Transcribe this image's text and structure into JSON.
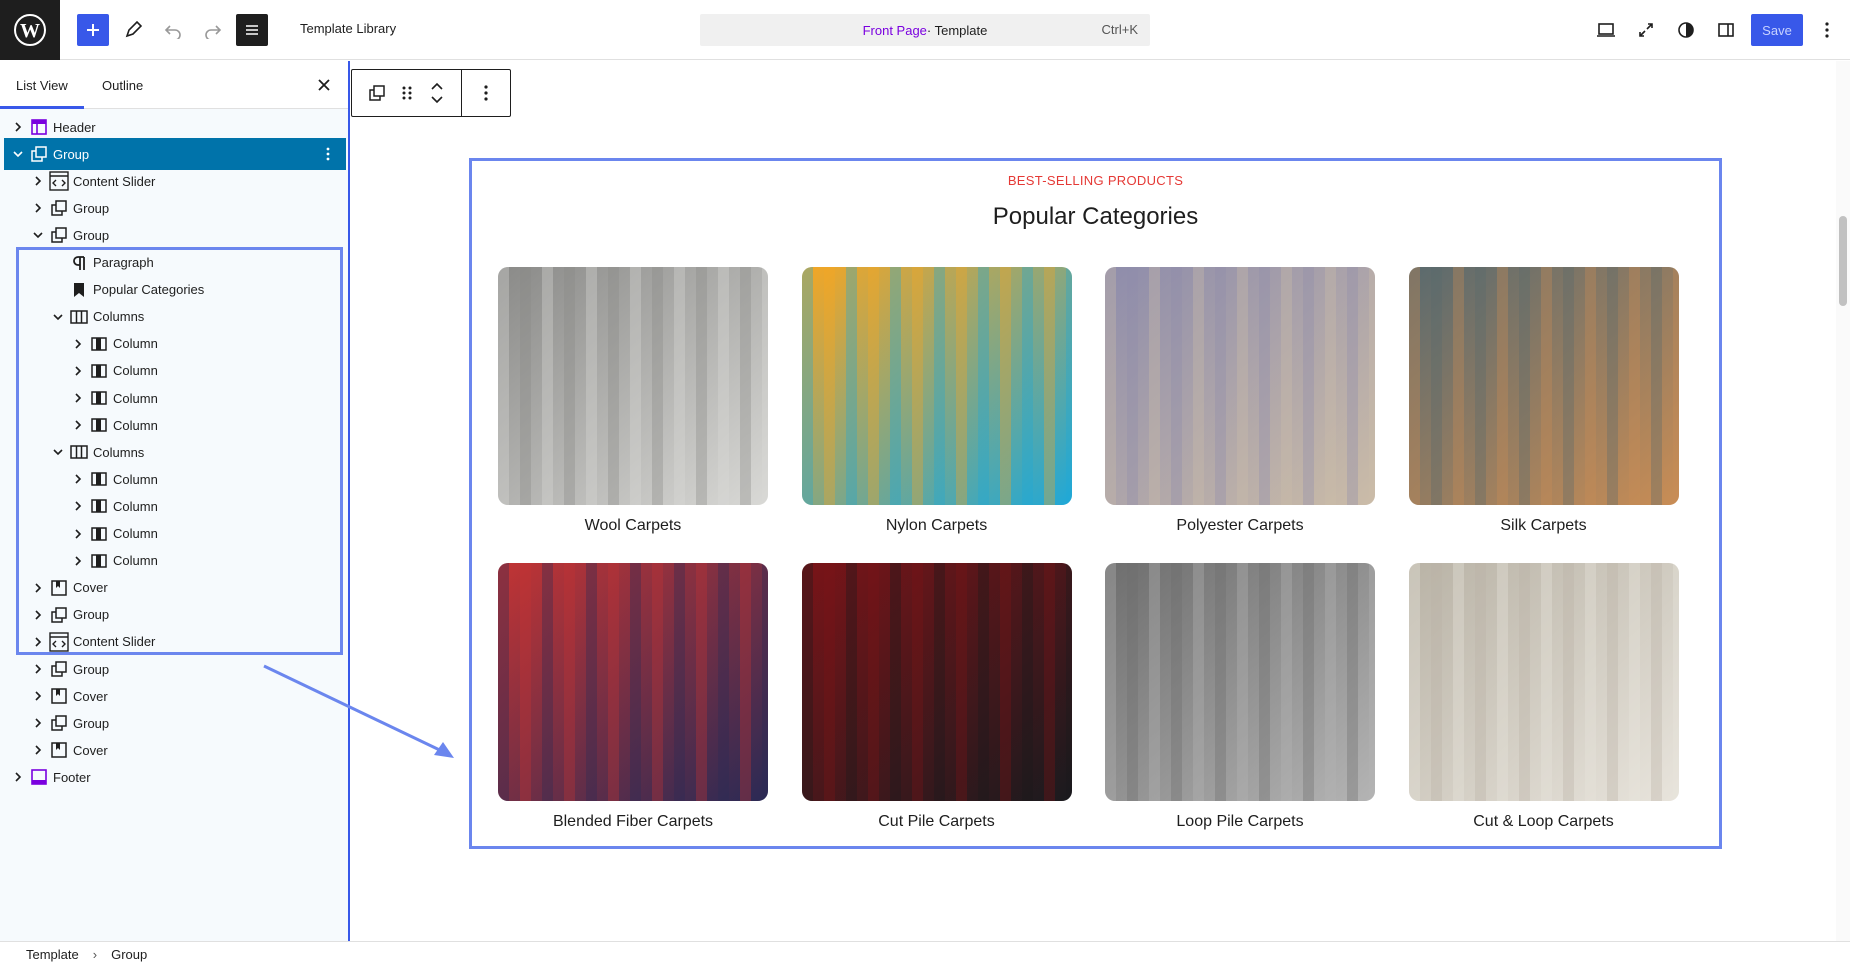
{
  "topbar": {
    "title": "Template Library",
    "command": {
      "page": "Front Page",
      "suffix": " · Template",
      "shortcut": "Ctrl+K"
    },
    "save_label": "Save"
  },
  "sidebar": {
    "tabs": [
      "List View",
      "Outline"
    ],
    "rows": [
      {
        "label": "Header",
        "depth": 0,
        "icon": "header",
        "chevron": "right",
        "sel": false
      },
      {
        "label": "Group",
        "depth": 0,
        "icon": "group",
        "chevron": "down",
        "sel": true
      },
      {
        "label": "Content Slider",
        "depth": 1,
        "icon": "slider",
        "chevron": "right",
        "sel": false
      },
      {
        "label": "Group",
        "depth": 1,
        "icon": "group",
        "chevron": "right",
        "sel": false
      },
      {
        "label": "Group",
        "depth": 1,
        "icon": "group",
        "chevron": "down",
        "sel": false
      },
      {
        "label": "Paragraph",
        "depth": 2,
        "icon": "paragraph",
        "chevron": "",
        "sel": false
      },
      {
        "label": "Popular Categories",
        "depth": 2,
        "icon": "bookmark",
        "chevron": "",
        "sel": false
      },
      {
        "label": "Columns",
        "depth": 2,
        "icon": "columns",
        "chevron": "down",
        "sel": false
      },
      {
        "label": "Column",
        "depth": 3,
        "icon": "column",
        "chevron": "right",
        "sel": false
      },
      {
        "label": "Column",
        "depth": 3,
        "icon": "column",
        "chevron": "right",
        "sel": false
      },
      {
        "label": "Column",
        "depth": 3,
        "icon": "column",
        "chevron": "right",
        "sel": false
      },
      {
        "label": "Column",
        "depth": 3,
        "icon": "column",
        "chevron": "right",
        "sel": false
      },
      {
        "label": "Columns",
        "depth": 2,
        "icon": "columns",
        "chevron": "down",
        "sel": false
      },
      {
        "label": "Column",
        "depth": 3,
        "icon": "column",
        "chevron": "right",
        "sel": false
      },
      {
        "label": "Column",
        "depth": 3,
        "icon": "column",
        "chevron": "right",
        "sel": false
      },
      {
        "label": "Column",
        "depth": 3,
        "icon": "column",
        "chevron": "right",
        "sel": false
      },
      {
        "label": "Column",
        "depth": 3,
        "icon": "column",
        "chevron": "right",
        "sel": false
      },
      {
        "label": "Cover",
        "depth": 1,
        "icon": "cover",
        "chevron": "right",
        "sel": false
      },
      {
        "label": "Group",
        "depth": 1,
        "icon": "group",
        "chevron": "right",
        "sel": false
      },
      {
        "label": "Content Slider",
        "depth": 1,
        "icon": "slider",
        "chevron": "right",
        "sel": false
      },
      {
        "label": "Group",
        "depth": 1,
        "icon": "group",
        "chevron": "right",
        "sel": false
      },
      {
        "label": "Cover",
        "depth": 1,
        "icon": "cover",
        "chevron": "right",
        "sel": false
      },
      {
        "label": "Group",
        "depth": 1,
        "icon": "group",
        "chevron": "right",
        "sel": false
      },
      {
        "label": "Cover",
        "depth": 1,
        "icon": "cover",
        "chevron": "right",
        "sel": false
      },
      {
        "label": "Footer",
        "depth": 0,
        "icon": "footer",
        "chevron": "right",
        "sel": false
      }
    ]
  },
  "content": {
    "eyebrow": "BEST-SELLING PRODUCTS",
    "heading": "Popular Categories",
    "cards": [
      {
        "caption": "Wool Carpets",
        "c1": "#8a8a88",
        "c2": "#d9d9d6"
      },
      {
        "caption": "Nylon Carpets",
        "c1": "#f5a623",
        "c2": "#1fa8d8"
      },
      {
        "caption": "Polyester Carpets",
        "c1": "#8e8cab",
        "c2": "#cbbca8"
      },
      {
        "caption": "Silk Carpets",
        "c1": "#5a6a6e",
        "c2": "#c98d55"
      },
      {
        "caption": "Blended Fiber Carpets",
        "c1": "#c23434",
        "c2": "#2a2a55"
      },
      {
        "caption": "Cut Pile Carpets",
        "c1": "#7a1418",
        "c2": "#1a1a1e"
      },
      {
        "caption": "Loop Pile Carpets",
        "c1": "#6e6e6e",
        "c2": "#b4b4b4"
      },
      {
        "caption": "Cut & Loop Carpets",
        "c1": "#b9b3a6",
        "c2": "#e8e4dc"
      }
    ]
  },
  "breadcrumb": [
    "Template",
    "Group"
  ],
  "colors": {
    "accent": "#3858e9",
    "selected": "#0073aa",
    "highlight": "#6b86ee",
    "eyebrow": "#e53935"
  }
}
